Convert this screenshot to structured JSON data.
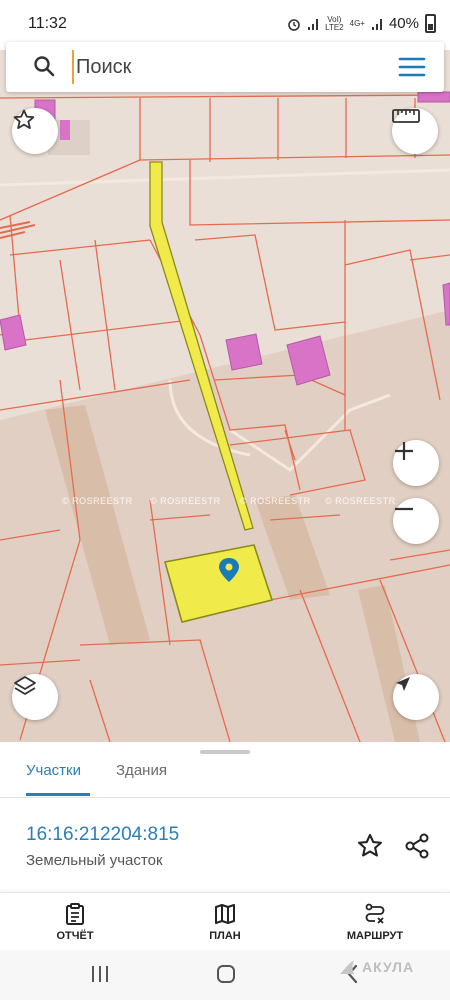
{
  "status": {
    "time": "11:32",
    "network_1": "VoI)",
    "network_2": "LTE2",
    "network_3": "4G+",
    "battery": "40%"
  },
  "search": {
    "placeholder": "Поиск"
  },
  "map": {
    "watermark": "© ROSREESTR"
  },
  "sheet": {
    "tabs": [
      {
        "label": "Участки",
        "active": true
      },
      {
        "label": "Здания",
        "active": false
      }
    ],
    "parcel": {
      "cadastral_number": "16:16:212204:815",
      "type": "Земельный участок"
    }
  },
  "actions": [
    {
      "label": "ОТЧЁТ",
      "icon": "clipboard-icon"
    },
    {
      "label": "ПЛАН",
      "icon": "map-icon"
    },
    {
      "label": "МАРШРУТ",
      "icon": "route-icon"
    }
  ],
  "branding": {
    "logo_text": "АКУЛА"
  },
  "colors": {
    "accent": "#2a7fb8",
    "parcel_fill": "#f1ea4b",
    "parcel_border": "#8a8a1a",
    "boundary": "#e56b4f",
    "building": "#d873c8",
    "map_bg": "#eadfd6"
  }
}
